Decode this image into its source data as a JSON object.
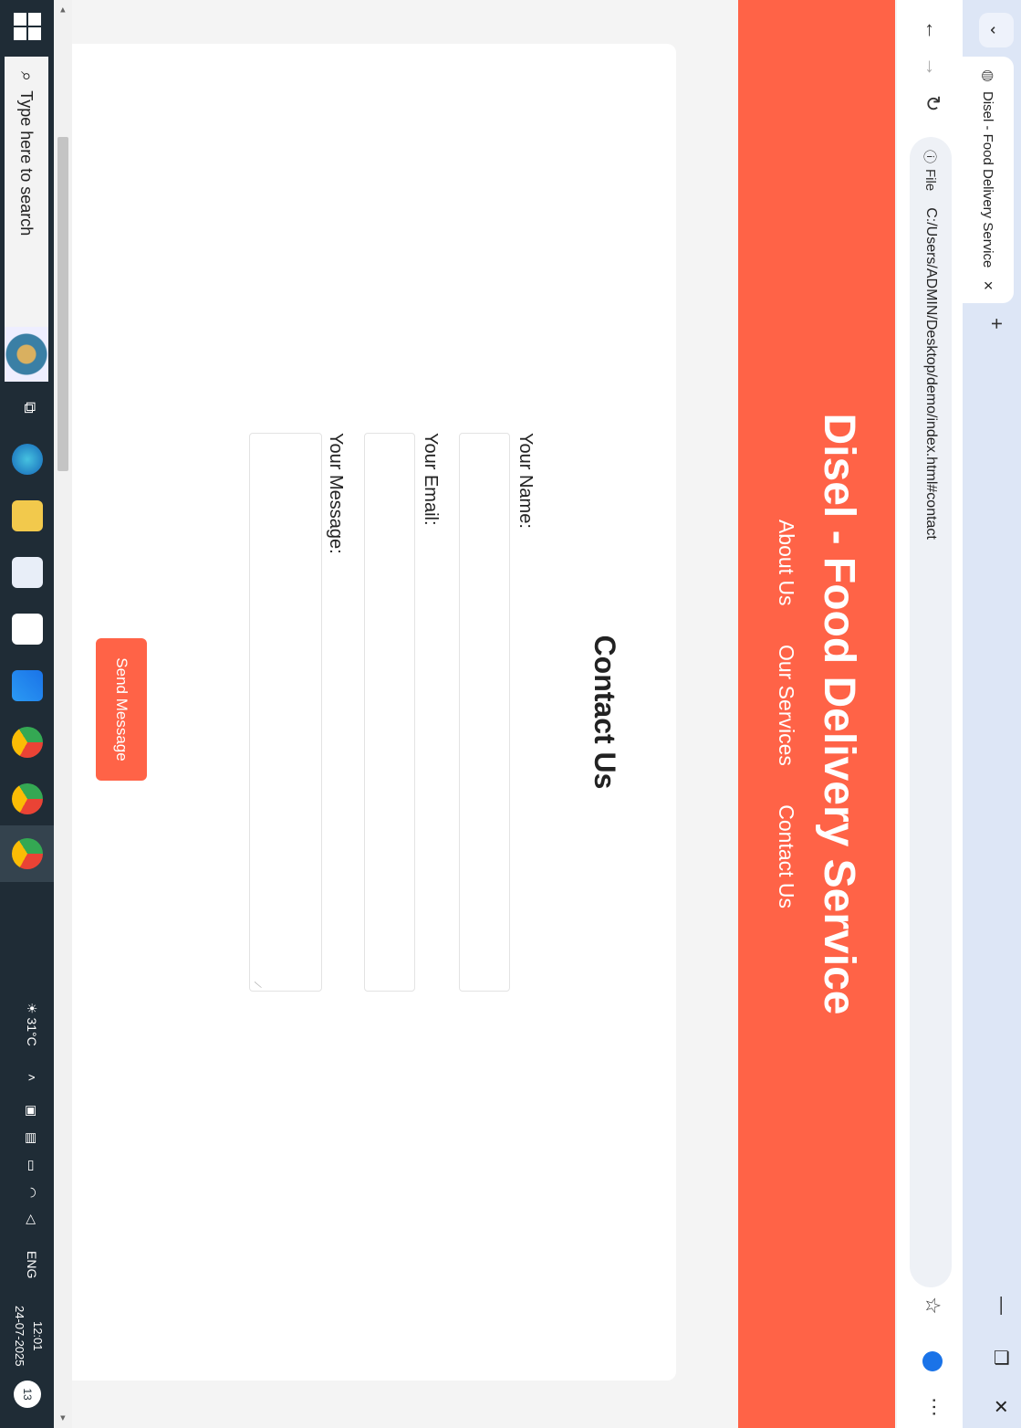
{
  "browser": {
    "tab_title": "Disel - Food Delivery Service",
    "address_chip": "File",
    "url": "C:/Users/ADMIN/Desktop/demo/index.html#contact"
  },
  "site": {
    "title": "Disel - Food Delivery Service",
    "nav": [
      "About Us",
      "Our Services",
      "Contact Us"
    ],
    "brand_color": "#ff6347"
  },
  "contact": {
    "heading": "Contact Us",
    "name_label": "Your Name:",
    "email_label": "Your Email:",
    "message_label": "Your Message:",
    "name_value": "",
    "email_value": "",
    "message_value": "",
    "submit_label": "Send Message"
  },
  "taskbar": {
    "search_placeholder": "Type here to search",
    "weather": "31°C",
    "language": "ENG",
    "time": "12:01",
    "date": "24-07-2025",
    "notification_count": "13"
  }
}
